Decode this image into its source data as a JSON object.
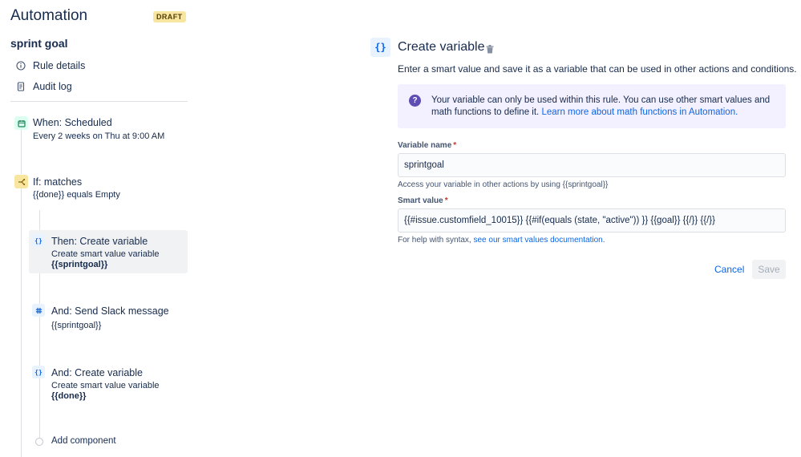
{
  "app": {
    "title": "Automation",
    "status_badge": "DRAFT"
  },
  "rule": {
    "name": "sprint goal",
    "nav": [
      {
        "label": "Rule details",
        "icon": "info-icon"
      },
      {
        "label": "Audit log",
        "icon": "document-icon"
      }
    ]
  },
  "steps": {
    "trigger": {
      "title": "When: Scheduled",
      "subtitle": "Every 2 weeks on Thu at 9:00 AM",
      "icon": "calendar-icon"
    },
    "condition": {
      "title": "If: matches",
      "subtitle": "{{done}} equals Empty",
      "icon": "branch-icon"
    },
    "action1": {
      "title": "Then: Create variable",
      "subtitle": "Create smart value variable",
      "value": "{{sprintgoal}}",
      "icon": "braces-icon",
      "selected": true
    },
    "action2": {
      "title": "And: Send Slack message",
      "subtitle": "{{sprintgoal}}",
      "icon": "slack-icon"
    },
    "action3": {
      "title": "And: Create variable",
      "subtitle": "Create smart value variable",
      "value": "{{done}}",
      "icon": "braces-icon"
    },
    "add_component": "Add component"
  },
  "panel": {
    "icon_glyph": "{}",
    "title": "Create variable",
    "description": "Enter a smart value and save it as a variable that can be used in other actions and conditions.",
    "info": {
      "text": "Your variable can only be used within this rule. You can use other smart values and math functions to define it.",
      "link": "Learn more about math functions in Automation."
    },
    "variable_name": {
      "label": "Variable name",
      "value": "sprintgoal",
      "help": "Access your variable in other actions by using {{sprintgoal}}"
    },
    "smart_value": {
      "label": "Smart value",
      "value": "{{#issue.customfield_10015}} {{#if(equals (state, \"active\")) }} {{goal}} {{/}} {{/}}",
      "help": "For help with syntax,",
      "help_link": "see our smart values documentation."
    },
    "buttons": {
      "cancel": "Cancel",
      "save": "Save"
    }
  },
  "colors": {
    "link": "#0c66e4",
    "info_bg": "#f3f0ff",
    "info_icon": "#5e4db2",
    "draft_bg": "#f8e6a0",
    "selected_step_bg": "#f1f2f4"
  }
}
